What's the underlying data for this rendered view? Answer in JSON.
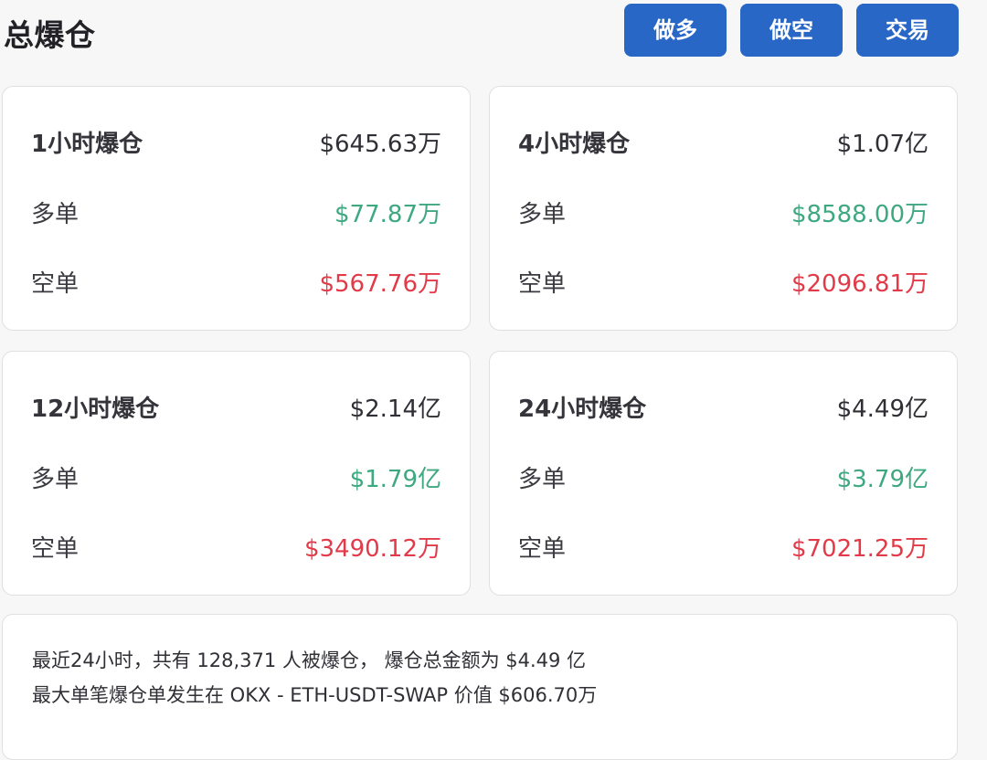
{
  "header": {
    "title": "总爆仓",
    "buttons": {
      "long": "做多",
      "short": "做空",
      "trade": "交易"
    }
  },
  "colors": {
    "button": "#2867c6",
    "long_value": "#3ea881",
    "short_value": "#e23a48"
  },
  "cards": [
    {
      "title": "1小时爆仓",
      "total": "$645.63万",
      "long_label": "多单",
      "long_value": "$77.87万",
      "short_label": "空单",
      "short_value": "$567.76万"
    },
    {
      "title": "4小时爆仓",
      "total": "$1.07亿",
      "long_label": "多单",
      "long_value": "$8588.00万",
      "short_label": "空单",
      "short_value": "$2096.81万"
    },
    {
      "title": "12小时爆仓",
      "total": "$2.14亿",
      "long_label": "多单",
      "long_value": "$1.79亿",
      "short_label": "空单",
      "short_value": "$3490.12万"
    },
    {
      "title": "24小时爆仓",
      "total": "$4.49亿",
      "long_label": "多单",
      "long_value": "$3.79亿",
      "short_label": "空单",
      "short_value": "$7021.25万"
    }
  ],
  "summary": {
    "line1": "最近24小时，共有 128,371 人被爆仓， 爆仓总金额为 $4.49 亿",
    "line2": "最大单笔爆仓单发生在 OKX - ETH-USDT-SWAP 价值 $606.70万"
  }
}
